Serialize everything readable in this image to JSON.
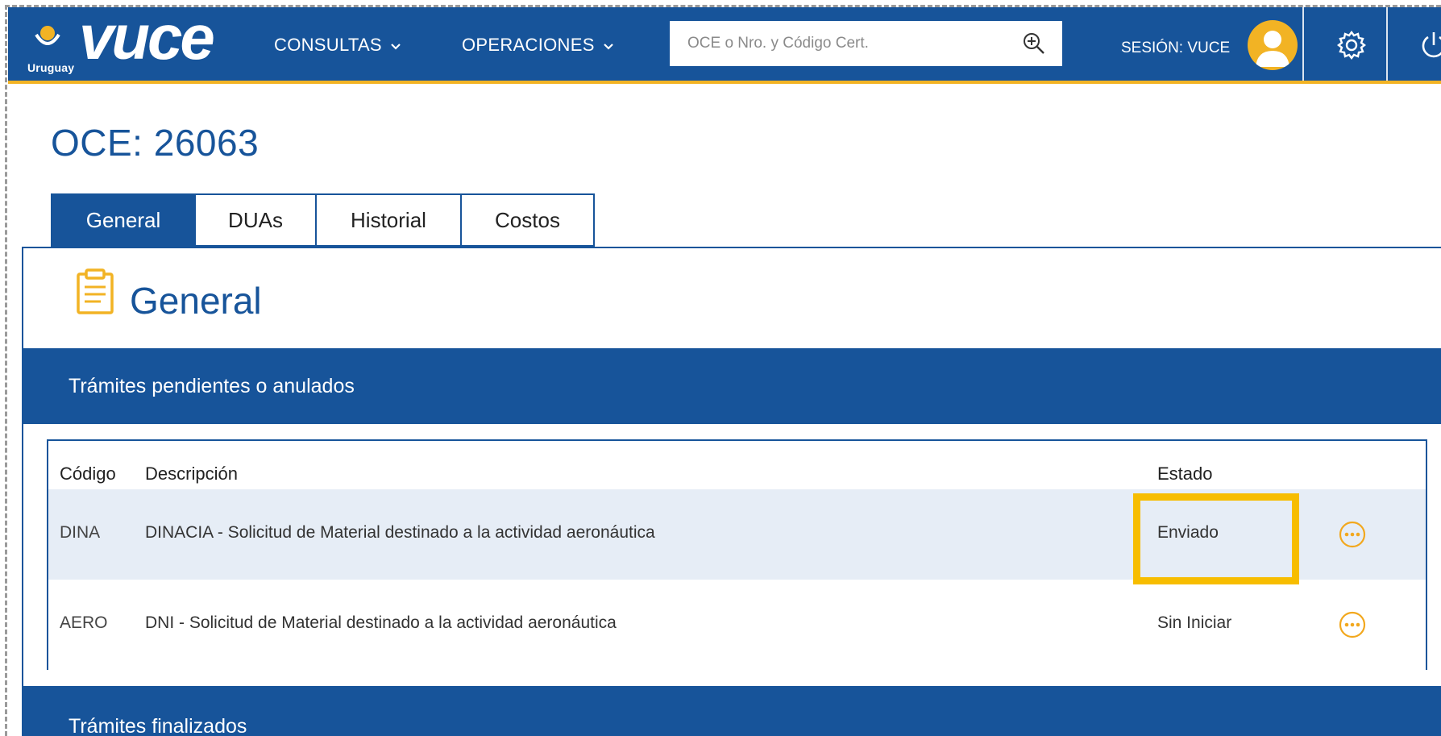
{
  "header": {
    "brand_country": "Uruguay",
    "brand_name": "VUCE",
    "nav": [
      {
        "label": "CONSULTAS"
      },
      {
        "label": "OPERACIONES"
      }
    ],
    "search_placeholder": "OCE o Nro. y Código Cert.",
    "session_label": "SESIÓN: VUCE"
  },
  "page": {
    "title": "OCE: 26063",
    "tabs": [
      {
        "label": "General",
        "active": true
      },
      {
        "label": "DUAs",
        "active": false
      },
      {
        "label": "Historial",
        "active": false
      },
      {
        "label": "Costos",
        "active": false
      }
    ]
  },
  "panel": {
    "title": "General",
    "pending_section": "Trámites pendientes o anulados",
    "finished_section": "Trámites finalizados",
    "table": {
      "headers": {
        "code": "Código",
        "description": "Descripción",
        "state": "Estado"
      },
      "rows": [
        {
          "code": "DINA",
          "description": "DINACIA - Solicitud de Material destinado a la actividad aeronáutica",
          "state": "Enviado"
        },
        {
          "code": "AERO",
          "description": "DNI - Solicitud de Material destinado a la actividad aeronáutica",
          "state": "Sin Iniciar"
        }
      ]
    }
  },
  "colors": {
    "primary": "#17549a",
    "accent": "#f2b324",
    "highlight": "#f7bd00",
    "row_alt": "#e6edf6"
  },
  "icons": [
    "uruguay-sun-icon",
    "chevron-down-icon",
    "search-zoom-icon",
    "user-avatar-icon",
    "gear-icon",
    "power-icon",
    "clipboard-icon",
    "more-options-icon"
  ]
}
